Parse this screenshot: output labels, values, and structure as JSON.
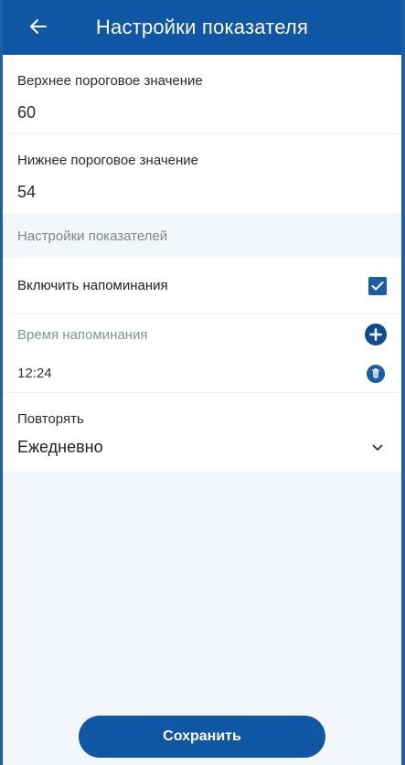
{
  "header": {
    "title": "Настройки показателя",
    "back_icon": "arrow-left-icon"
  },
  "upper_threshold": {
    "label": "Верхнее пороговое значение",
    "value": "60"
  },
  "lower_threshold": {
    "label": "Нижнее пороговое значение",
    "value": "54"
  },
  "section": {
    "title": "Настройки показателей"
  },
  "reminders": {
    "toggle_label": "Включить напоминания",
    "enabled": true,
    "time_label": "Время напоминания",
    "add_icon": "plus-circle-icon",
    "times": [
      "12:24"
    ],
    "delete_icon": "trash-icon"
  },
  "repeat": {
    "label": "Повторять",
    "selected": "Ежедневно",
    "dropdown_icon": "chevron-down-icon"
  },
  "footer": {
    "save_label": "Сохранить"
  },
  "colors": {
    "primary": "#0f56a5",
    "background": "#f3f6fb",
    "muted_text": "#8a8f96"
  }
}
